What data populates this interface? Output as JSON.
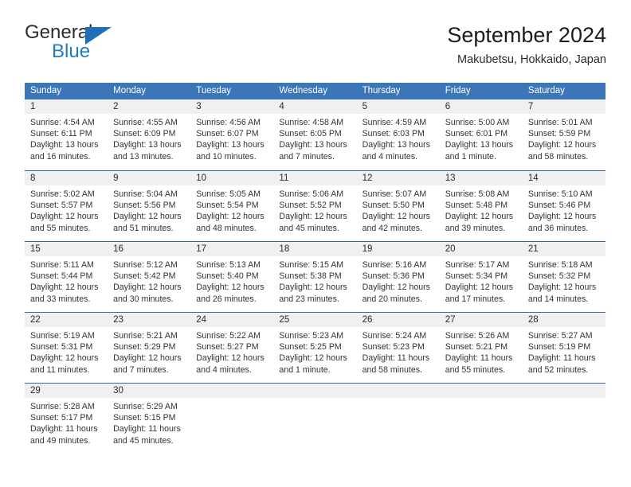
{
  "logo": {
    "word_top": "General",
    "word_bottom": "Blue",
    "triangle": "blue-triangle-icon",
    "color_top": "#2b2b2b",
    "color_bottom": "#1f7cc4",
    "color_triangle": "#1f6fb8"
  },
  "header": {
    "title": "September 2024",
    "subtitle": "Makubetsu, Hokkaido, Japan"
  },
  "theme": {
    "header_blue": "#3b77b8",
    "row_divider_blue": "#2e6da8",
    "daynum_band": "#f0f0f0",
    "text": "#333333"
  },
  "weekday_headers": [
    "Sunday",
    "Monday",
    "Tuesday",
    "Wednesday",
    "Thursday",
    "Friday",
    "Saturday"
  ],
  "weeks": [
    {
      "days": [
        {
          "num": "1",
          "sunrise": "Sunrise: 4:54 AM",
          "sunset": "Sunset: 6:11 PM",
          "daylight1": "Daylight: 13 hours",
          "daylight2": "and 16 minutes."
        },
        {
          "num": "2",
          "sunrise": "Sunrise: 4:55 AM",
          "sunset": "Sunset: 6:09 PM",
          "daylight1": "Daylight: 13 hours",
          "daylight2": "and 13 minutes."
        },
        {
          "num": "3",
          "sunrise": "Sunrise: 4:56 AM",
          "sunset": "Sunset: 6:07 PM",
          "daylight1": "Daylight: 13 hours",
          "daylight2": "and 10 minutes."
        },
        {
          "num": "4",
          "sunrise": "Sunrise: 4:58 AM",
          "sunset": "Sunset: 6:05 PM",
          "daylight1": "Daylight: 13 hours",
          "daylight2": "and 7 minutes."
        },
        {
          "num": "5",
          "sunrise": "Sunrise: 4:59 AM",
          "sunset": "Sunset: 6:03 PM",
          "daylight1": "Daylight: 13 hours",
          "daylight2": "and 4 minutes."
        },
        {
          "num": "6",
          "sunrise": "Sunrise: 5:00 AM",
          "sunset": "Sunset: 6:01 PM",
          "daylight1": "Daylight: 13 hours",
          "daylight2": "and 1 minute."
        },
        {
          "num": "7",
          "sunrise": "Sunrise: 5:01 AM",
          "sunset": "Sunset: 5:59 PM",
          "daylight1": "Daylight: 12 hours",
          "daylight2": "and 58 minutes."
        }
      ]
    },
    {
      "days": [
        {
          "num": "8",
          "sunrise": "Sunrise: 5:02 AM",
          "sunset": "Sunset: 5:57 PM",
          "daylight1": "Daylight: 12 hours",
          "daylight2": "and 55 minutes."
        },
        {
          "num": "9",
          "sunrise": "Sunrise: 5:04 AM",
          "sunset": "Sunset: 5:56 PM",
          "daylight1": "Daylight: 12 hours",
          "daylight2": "and 51 minutes."
        },
        {
          "num": "10",
          "sunrise": "Sunrise: 5:05 AM",
          "sunset": "Sunset: 5:54 PM",
          "daylight1": "Daylight: 12 hours",
          "daylight2": "and 48 minutes."
        },
        {
          "num": "11",
          "sunrise": "Sunrise: 5:06 AM",
          "sunset": "Sunset: 5:52 PM",
          "daylight1": "Daylight: 12 hours",
          "daylight2": "and 45 minutes."
        },
        {
          "num": "12",
          "sunrise": "Sunrise: 5:07 AM",
          "sunset": "Sunset: 5:50 PM",
          "daylight1": "Daylight: 12 hours",
          "daylight2": "and 42 minutes."
        },
        {
          "num": "13",
          "sunrise": "Sunrise: 5:08 AM",
          "sunset": "Sunset: 5:48 PM",
          "daylight1": "Daylight: 12 hours",
          "daylight2": "and 39 minutes."
        },
        {
          "num": "14",
          "sunrise": "Sunrise: 5:10 AM",
          "sunset": "Sunset: 5:46 PM",
          "daylight1": "Daylight: 12 hours",
          "daylight2": "and 36 minutes."
        }
      ]
    },
    {
      "days": [
        {
          "num": "15",
          "sunrise": "Sunrise: 5:11 AM",
          "sunset": "Sunset: 5:44 PM",
          "daylight1": "Daylight: 12 hours",
          "daylight2": "and 33 minutes."
        },
        {
          "num": "16",
          "sunrise": "Sunrise: 5:12 AM",
          "sunset": "Sunset: 5:42 PM",
          "daylight1": "Daylight: 12 hours",
          "daylight2": "and 30 minutes."
        },
        {
          "num": "17",
          "sunrise": "Sunrise: 5:13 AM",
          "sunset": "Sunset: 5:40 PM",
          "daylight1": "Daylight: 12 hours",
          "daylight2": "and 26 minutes."
        },
        {
          "num": "18",
          "sunrise": "Sunrise: 5:15 AM",
          "sunset": "Sunset: 5:38 PM",
          "daylight1": "Daylight: 12 hours",
          "daylight2": "and 23 minutes."
        },
        {
          "num": "19",
          "sunrise": "Sunrise: 5:16 AM",
          "sunset": "Sunset: 5:36 PM",
          "daylight1": "Daylight: 12 hours",
          "daylight2": "and 20 minutes."
        },
        {
          "num": "20",
          "sunrise": "Sunrise: 5:17 AM",
          "sunset": "Sunset: 5:34 PM",
          "daylight1": "Daylight: 12 hours",
          "daylight2": "and 17 minutes."
        },
        {
          "num": "21",
          "sunrise": "Sunrise: 5:18 AM",
          "sunset": "Sunset: 5:32 PM",
          "daylight1": "Daylight: 12 hours",
          "daylight2": "and 14 minutes."
        }
      ]
    },
    {
      "days": [
        {
          "num": "22",
          "sunrise": "Sunrise: 5:19 AM",
          "sunset": "Sunset: 5:31 PM",
          "daylight1": "Daylight: 12 hours",
          "daylight2": "and 11 minutes."
        },
        {
          "num": "23",
          "sunrise": "Sunrise: 5:21 AM",
          "sunset": "Sunset: 5:29 PM",
          "daylight1": "Daylight: 12 hours",
          "daylight2": "and 7 minutes."
        },
        {
          "num": "24",
          "sunrise": "Sunrise: 5:22 AM",
          "sunset": "Sunset: 5:27 PM",
          "daylight1": "Daylight: 12 hours",
          "daylight2": "and 4 minutes."
        },
        {
          "num": "25",
          "sunrise": "Sunrise: 5:23 AM",
          "sunset": "Sunset: 5:25 PM",
          "daylight1": "Daylight: 12 hours",
          "daylight2": "and 1 minute."
        },
        {
          "num": "26",
          "sunrise": "Sunrise: 5:24 AM",
          "sunset": "Sunset: 5:23 PM",
          "daylight1": "Daylight: 11 hours",
          "daylight2": "and 58 minutes."
        },
        {
          "num": "27",
          "sunrise": "Sunrise: 5:26 AM",
          "sunset": "Sunset: 5:21 PM",
          "daylight1": "Daylight: 11 hours",
          "daylight2": "and 55 minutes."
        },
        {
          "num": "28",
          "sunrise": "Sunrise: 5:27 AM",
          "sunset": "Sunset: 5:19 PM",
          "daylight1": "Daylight: 11 hours",
          "daylight2": "and 52 minutes."
        }
      ]
    },
    {
      "days": [
        {
          "num": "29",
          "sunrise": "Sunrise: 5:28 AM",
          "sunset": "Sunset: 5:17 PM",
          "daylight1": "Daylight: 11 hours",
          "daylight2": "and 49 minutes."
        },
        {
          "num": "30",
          "sunrise": "Sunrise: 5:29 AM",
          "sunset": "Sunset: 5:15 PM",
          "daylight1": "Daylight: 11 hours",
          "daylight2": "and 45 minutes."
        },
        {
          "num": "",
          "sunrise": "",
          "sunset": "",
          "daylight1": "",
          "daylight2": ""
        },
        {
          "num": "",
          "sunrise": "",
          "sunset": "",
          "daylight1": "",
          "daylight2": ""
        },
        {
          "num": "",
          "sunrise": "",
          "sunset": "",
          "daylight1": "",
          "daylight2": ""
        },
        {
          "num": "",
          "sunrise": "",
          "sunset": "",
          "daylight1": "",
          "daylight2": ""
        },
        {
          "num": "",
          "sunrise": "",
          "sunset": "",
          "daylight1": "",
          "daylight2": ""
        }
      ]
    }
  ]
}
